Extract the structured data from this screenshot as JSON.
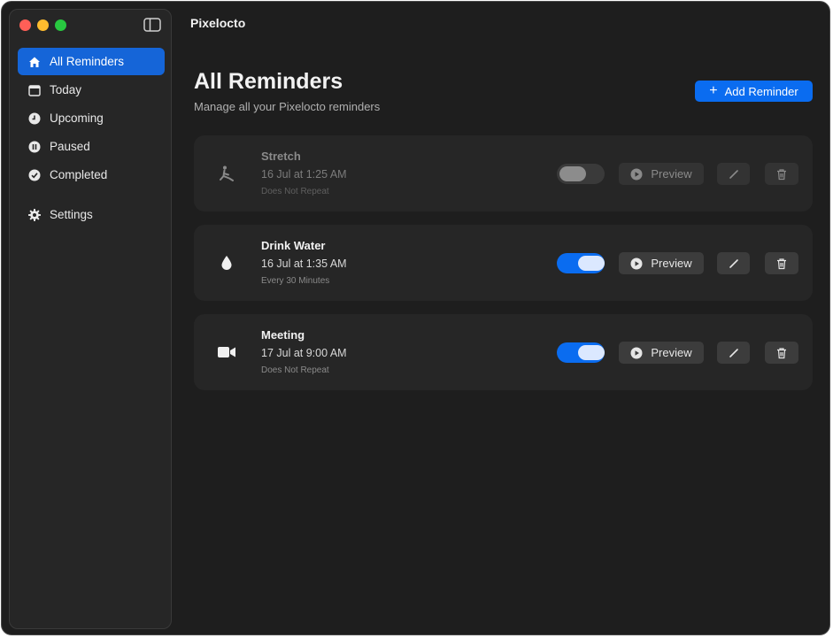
{
  "app": {
    "title": "Pixelocto"
  },
  "sidebar": {
    "items": [
      {
        "label": "All Reminders",
        "icon": "house-icon",
        "active": true
      },
      {
        "label": "Today",
        "icon": "calendar-icon",
        "active": false
      },
      {
        "label": "Upcoming",
        "icon": "clock-icon",
        "active": false
      },
      {
        "label": "Paused",
        "icon": "pause-icon",
        "active": false
      },
      {
        "label": "Completed",
        "icon": "checkmark-circle-icon",
        "active": false
      },
      {
        "label": "Settings",
        "icon": "gear-icon",
        "active": false
      }
    ]
  },
  "header": {
    "title": "All Reminders",
    "subtitle": "Manage all your Pixelocto reminders",
    "add_label": "Add Reminder"
  },
  "reminders": [
    {
      "name": "Stretch",
      "time": "16 Jul at 1:25 AM",
      "repeat": "Does Not Repeat",
      "enabled": false,
      "icon": "stretch-icon",
      "preview_label": "Preview"
    },
    {
      "name": "Drink Water",
      "time": "16 Jul at 1:35 AM",
      "repeat": "Every 30 Minutes",
      "enabled": true,
      "icon": "water-drop-icon",
      "preview_label": "Preview"
    },
    {
      "name": "Meeting",
      "time": "17 Jul at 9:00 AM",
      "repeat": "Does Not Repeat",
      "enabled": true,
      "icon": "video-camera-icon",
      "preview_label": "Preview"
    }
  ],
  "colors": {
    "accent": "#0a6cf0",
    "background": "#1e1e1e",
    "sidebar": "#262626",
    "card": "#262626"
  }
}
